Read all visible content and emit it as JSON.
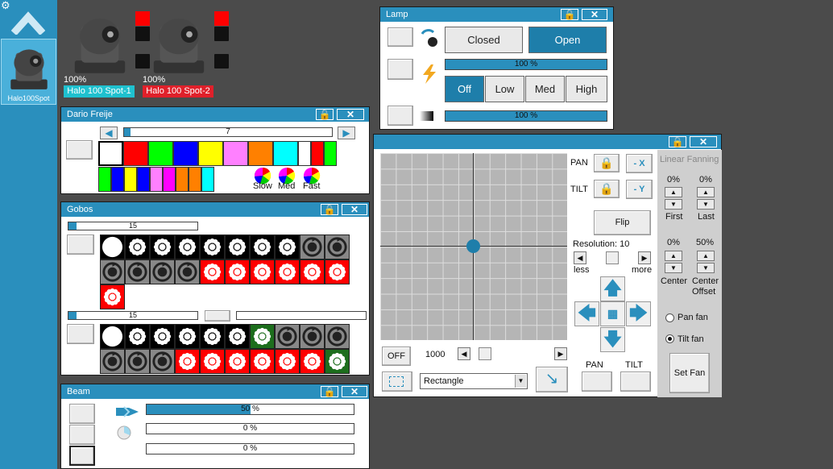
{
  "sidebar": {
    "fixture_label": "Halo100Spot",
    "icons": [
      "gear-icon",
      "chevron-up-icon"
    ]
  },
  "fixtures": [
    {
      "percent": "100%",
      "name": "Halo 100 Spot-1",
      "color": "#1fc1cf"
    },
    {
      "percent": "100%",
      "name": "Halo 100 Spot-2",
      "color": "#e0202a"
    }
  ],
  "lamp": {
    "title": "Lamp",
    "closed": "Closed",
    "open": "Open",
    "dimmer": "100 %",
    "mode_off": "Off",
    "mode_low": "Low",
    "mode_med": "Med",
    "mode_high": "High",
    "intensity": "100 %",
    "dimmer_level": 1.0,
    "intensity_level": 1.0
  },
  "color": {
    "title": "Dario Freije",
    "slider_value": "7",
    "speed_slow": "Slow",
    "speed_med": "Med",
    "speed_fast": "Fast",
    "row1": [
      "#ffffff",
      "#ff0000",
      "#00ff00",
      "#0000ff",
      "#ffff00",
      "#ff80ff",
      "#ff8000",
      "#00ffff",
      "#ffffff",
      "#ff0000",
      "#00ff00"
    ],
    "row2": [
      "#00ff00",
      "#0000ff",
      "#ffff00",
      "#0000ff",
      "#ff80ff",
      "#ff00ff",
      "#ff8000",
      "#ff8000",
      "#00ffff"
    ]
  },
  "gobos": {
    "title": "Gobos",
    "wheel1_value": "15",
    "wheel2_value": "15"
  },
  "beam": {
    "title": "Beam",
    "focus": "50 %",
    "frost": "0 %",
    "prism": "0 %",
    "focus_level": 0.5
  },
  "pantilt": {
    "pan_label": "PAN",
    "tilt_label": "TILT",
    "minus_x": "- X",
    "minus_y": "- Y",
    "flip": "Flip",
    "resolution": "Resolution: 10",
    "less": "less",
    "more": "more",
    "off": "OFF",
    "speed_value": "1000",
    "shape": "Rectangle",
    "pan_bottom": "PAN",
    "tilt_bottom": "TILT"
  },
  "fanning": {
    "title": "Linear Fanning",
    "first_pct": "0%",
    "last_pct": "0%",
    "first": "First",
    "last": "Last",
    "center_pct": "0%",
    "offset_pct": "50%",
    "center": "Center",
    "center_offset": "Center Offset",
    "pan_fan": "Pan fan",
    "tilt_fan": "Tilt fan",
    "set_fan": "Set Fan"
  }
}
